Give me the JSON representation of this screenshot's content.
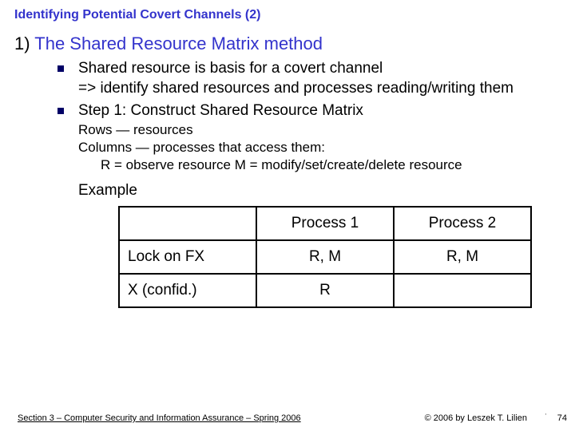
{
  "title": "Identifying Potential Covert Channels (2)",
  "heading": {
    "num": "1)",
    "rest": " The Shared Resource Matrix method"
  },
  "bullets": [
    {
      "lines": [
        "Shared resource is basis for a covert channel",
        "=> identify shared resources and processes reading/writing them"
      ]
    },
    {
      "lines": [
        "Step 1: Construct Shared Resource Matrix"
      ]
    }
  ],
  "sub": {
    "line1": "Rows — resources",
    "line2": "Columns — processes that access them:",
    "line3": "R = observe resource   M = modify/set/create/delete resource"
  },
  "example_label": "Example",
  "table": {
    "headers": [
      "",
      "Process 1",
      "Process 2"
    ],
    "rows": [
      {
        "label": "Lock on FX",
        "c1": "R, M",
        "c2": "R, M"
      },
      {
        "label": "X (confid.)",
        "c1": "R",
        "c2": ""
      }
    ]
  },
  "footer": "Section 3 – Computer Security and Information Assurance – Spring 2006",
  "copyright": "© 2006 by Leszek T. Lilien",
  "pagenum": "74"
}
